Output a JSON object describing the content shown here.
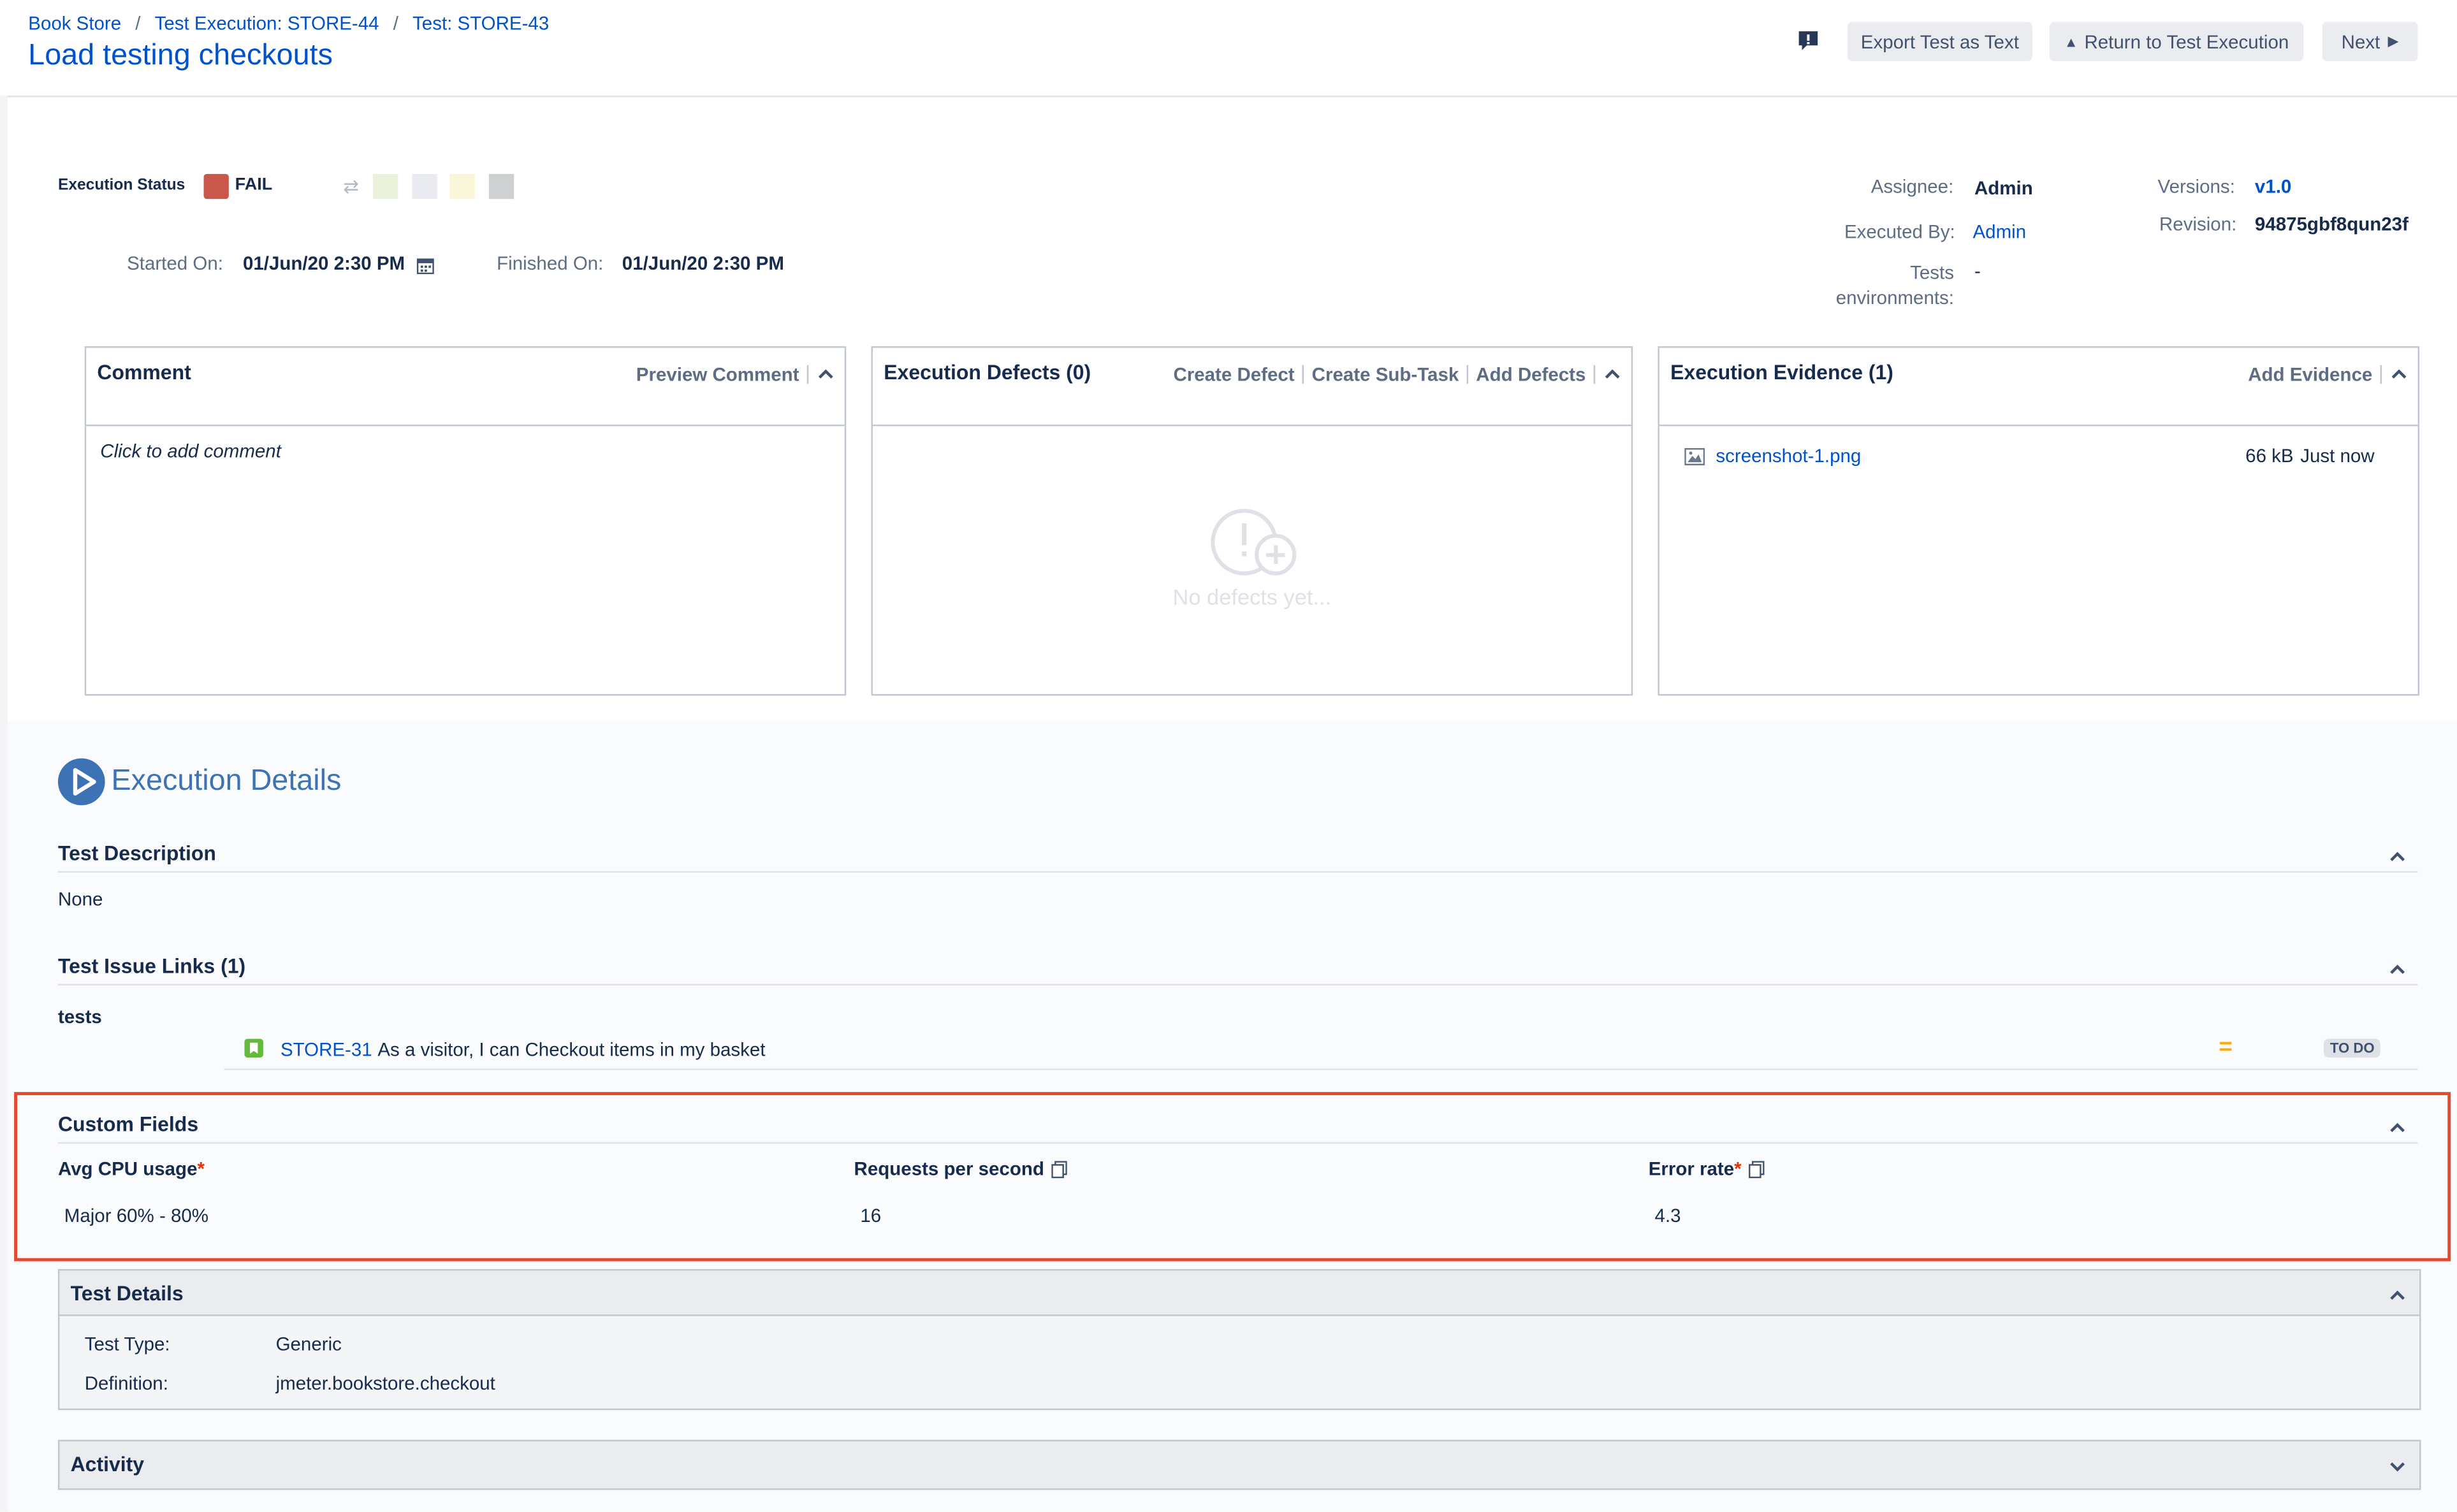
{
  "breadcrumb": [
    "Book Store",
    "Test Execution: STORE-44",
    "Test: STORE-43"
  ],
  "page_title": "Load testing checkouts",
  "toolbar": {
    "export_label": "Export Test as Text",
    "return_label": "Return to Test Execution",
    "next_label": "Next"
  },
  "execution": {
    "status_label": "Execution Status",
    "status_value": "FAIL",
    "status_color": "#c9584b",
    "started_label": "Started On:",
    "started_value": "01/Jun/20 2:30 PM",
    "finished_label": "Finished On:",
    "finished_value": "01/Jun/20 2:30 PM"
  },
  "meta": {
    "assignee_label": "Assignee:",
    "assignee_value": "Admin",
    "executed_by_label": "Executed By:",
    "executed_by_value": "Admin",
    "tests_env_label_1": "Tests",
    "tests_env_label_2": "environments:",
    "tests_env_value": "-",
    "versions_label": "Versions:",
    "versions_value": "v1.0",
    "revision_label": "Revision:",
    "revision_value": "94875gbf8qun23f"
  },
  "comment_panel": {
    "title": "Comment",
    "action": "Preview Comment",
    "placeholder": "Click to add comment"
  },
  "defects_panel": {
    "title": "Execution Defects (0)",
    "actions": [
      "Create Defect",
      "Create Sub-Task",
      "Add Defects"
    ],
    "empty_text": "No defects yet..."
  },
  "evidence_panel": {
    "title": "Execution Evidence (1)",
    "action": "Add Evidence",
    "file_name": "screenshot-1.png",
    "file_size": "66 kB",
    "file_time": "Just now"
  },
  "details_heading": "Execution Details",
  "test_description": {
    "title": "Test Description",
    "value": "None"
  },
  "issue_links": {
    "title": "Test Issue Links (1)",
    "group_label": "tests",
    "key": "STORE-31",
    "summary": "As a visitor, I can Checkout items in my basket",
    "priority_symbol": "=",
    "status": "TO DO"
  },
  "custom_fields": {
    "title": "Custom Fields",
    "fields": [
      {
        "label": "Avg CPU usage",
        "required": "*",
        "value": "Major 60% - 80%"
      },
      {
        "label": "Requests per second",
        "required": "",
        "value": "16"
      },
      {
        "label": "Error rate",
        "required": "*",
        "value": "4.3"
      }
    ]
  },
  "test_details": {
    "title": "Test Details",
    "type_label": "Test Type:",
    "type_value": "Generic",
    "definition_label": "Definition:",
    "definition_value": "jmeter.bookstore.checkout"
  },
  "activity": {
    "title": "Activity"
  },
  "colors": {
    "link": "#0052cc",
    "highlight_border": "#e5492d",
    "fail": "#c9584b",
    "details_icon": "#3d72b4"
  }
}
